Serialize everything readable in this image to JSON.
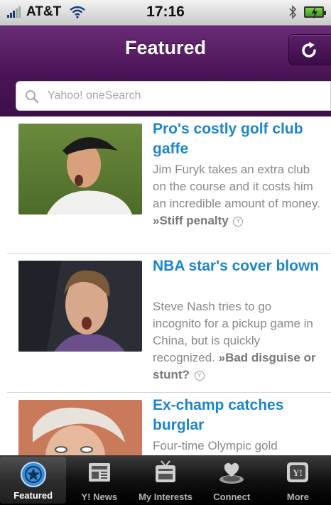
{
  "status": {
    "carrier": "AT&T",
    "time": "17:16"
  },
  "nav": {
    "title": "Featured",
    "refresh_icon": "refresh-icon"
  },
  "search": {
    "placeholder": "Yahoo! oneSearch"
  },
  "articles": [
    {
      "headline": "Pro's costly golf club gaffe",
      "summary": "Jim Furyk takes an extra club on the course and it costs him an incredible amount of money.",
      "link": "»Stiff penalty"
    },
    {
      "headline": "NBA star's cover blown",
      "summary": "Steve Nash tries to go incognito for a pickup game in China, but is quickly recognized.",
      "link": "»Bad disguise or stunt?"
    },
    {
      "headline": "Ex-champ catches burglar",
      "summary": "Four-time Olympic gold",
      "link": ""
    }
  ],
  "tabs": [
    {
      "label": "Featured",
      "icon": "star-icon"
    },
    {
      "label": "Y! News",
      "icon": "newspaper-icon"
    },
    {
      "label": "My Interests",
      "icon": "tv-icon"
    },
    {
      "label": "Connect",
      "icon": "connect-icon"
    },
    {
      "label": "More",
      "icon": "yahoo-icon"
    }
  ],
  "colors": {
    "accent": "#4a1456",
    "headline": "#1c86c8"
  }
}
